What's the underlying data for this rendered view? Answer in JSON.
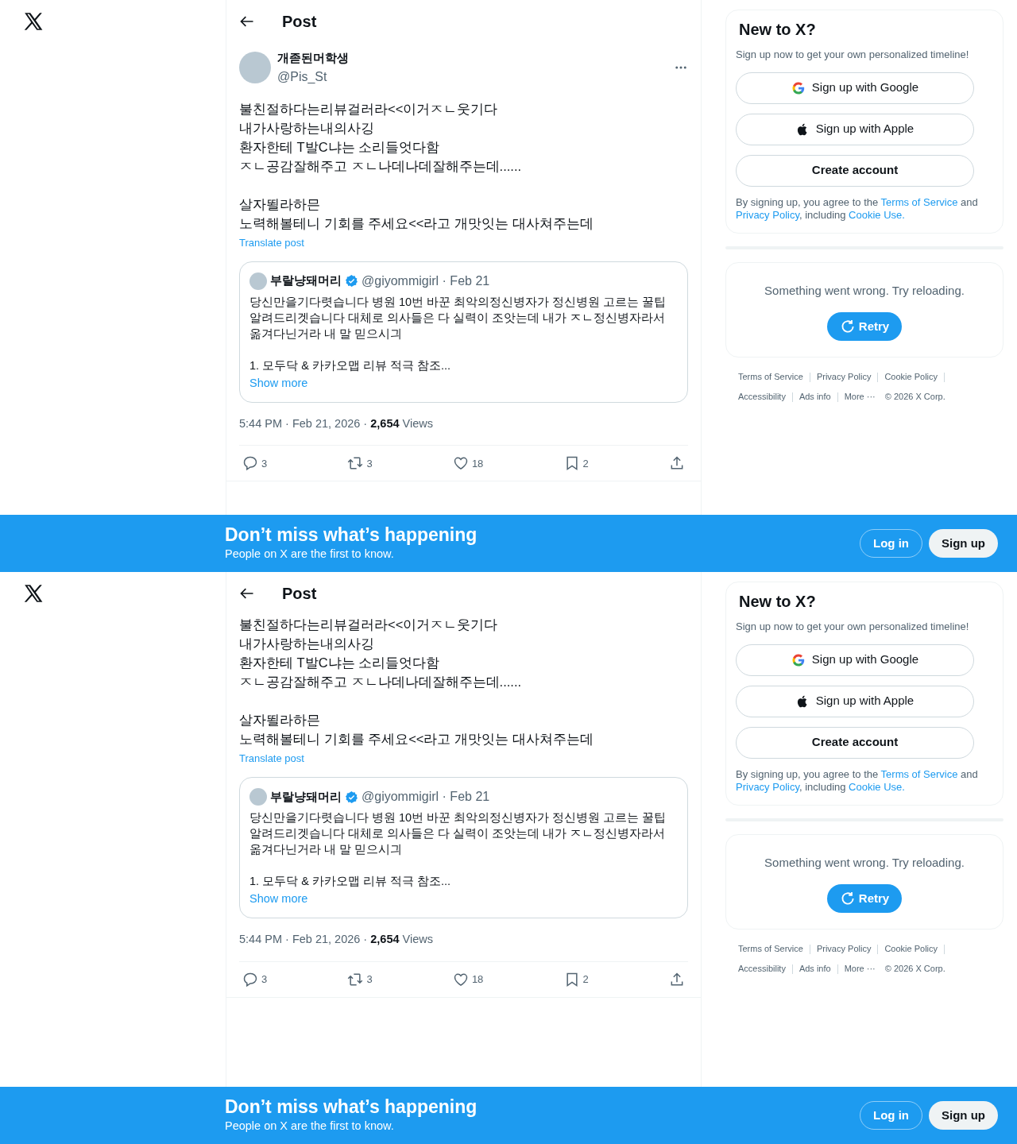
{
  "screens": [
    {
      "header": {
        "title": "Post"
      },
      "author": {
        "name": "개졷된머학생",
        "handle": "@Pis_St"
      },
      "body": [
        [
          "불친절하다는리뷰걸러라<<이거ㅈㄴ웃기다",
          "내가사랑하는내의사깅",
          "환자한테 T발C냐는 소리들엇다함",
          "ㅈㄴ공감잘해주고 ㅈㄴ나데나데잘해주는데......"
        ],
        [
          "살자뙬라하믄",
          "노력해볼테니 기회를 주세요<<라고 개맛잇는 대사쳐주는데"
        ]
      ],
      "translate": "Translate post",
      "quote": {
        "name": "부랄냥돼머리",
        "verified": true,
        "handle": "@giyommigirl · Feb 21",
        "text": [
          "당신만을기다렷습니다 병원 10번 바꾼 최악의정신병자가 정신병원 고르는 꿀팁 알려드리겟습니다 대체로 의사들은 다 실력이 조앗는데 내가 ㅈㄴ정신병자라서 옮겨다닌거라 내 말 믿으시긔",
          "1. 모두닥 & 카카오맵 리뷰 적극 참조..."
        ],
        "more": "Show more"
      },
      "meta": {
        "time": "5:44 PM · Feb 21, 2026 · ",
        "views": "2,654",
        "views_label": " Views"
      },
      "actions": [
        {
          "kind": "reply",
          "count": "3"
        },
        {
          "kind": "repost",
          "count": "3"
        },
        {
          "kind": "like",
          "count": "18"
        },
        {
          "kind": "bookmark",
          "count": "2"
        },
        {
          "kind": "share"
        }
      ],
      "signup": {
        "title": "New to X?",
        "subtitle": "Sign up now to get your own personalized timeline!",
        "buttons": [
          {
            "kind": "google",
            "label": "Sign up with Google"
          },
          {
            "kind": "apple",
            "label": "Sign up with Apple"
          },
          {
            "kind": "create",
            "label": "Create account"
          }
        ],
        "legal": [
          {
            "text": "By signing up, you agree to the ",
            "link": false
          },
          {
            "text": "Terms of Service",
            "link": true
          },
          {
            "text": " and ",
            "link": false
          },
          {
            "text": "Privacy Policy",
            "link": true
          },
          {
            "text": ", including ",
            "link": false
          },
          {
            "text": "Cookie Use.",
            "link": true
          }
        ]
      },
      "error": {
        "message": "Something went wrong. Try reloading.",
        "retry": "Retry"
      },
      "footer": [
        "Terms of Service",
        "Privacy Policy",
        "Cookie Policy",
        "Accessibility",
        "Ads info",
        "More ···",
        "© 2026 X Corp."
      ],
      "banner": {
        "title": "Don’t miss what’s happening",
        "subtitle": "People on X are the first to know.",
        "login": "Log in",
        "signup": "Sign up"
      }
    },
    {
      "header": {
        "title": "Post"
      },
      "body": [
        [
          "불친절하다는리뷰걸러라<<이거ㅈㄴ웃기다",
          "내가사랑하는내의사깅",
          "환자한테 T발C냐는 소리들엇다함",
          "ㅈㄴ공감잘해주고 ㅈㄴ나데나데잘해주는데......"
        ],
        [
          "살자뙬라하믄",
          "노력해볼테니 기회를 주세요<<라고 개맛잇는 대사쳐주는데"
        ]
      ],
      "translate": "Translate post",
      "quote": {
        "name": "부랄냥돼머리",
        "verified": true,
        "handle": "@giyommigirl · Feb 21",
        "text": [
          "당신만을기다렷습니다 병원 10번 바꾼 최악의정신병자가 정신병원 고르는 꿀팁 알려드리겟습니다 대체로 의사들은 다 실력이 조앗는데 내가 ㅈㄴ정신병자라서 옮겨다닌거라 내 말 믿으시긔",
          "1. 모두닥 & 카카오맵 리뷰 적극 참조..."
        ],
        "more": "Show more"
      },
      "meta": {
        "time": "5:44 PM · Feb 21, 2026 · ",
        "views": "2,654",
        "views_label": " Views"
      },
      "actions": [
        {
          "kind": "reply",
          "count": "3"
        },
        {
          "kind": "repost",
          "count": "3"
        },
        {
          "kind": "like",
          "count": "18"
        },
        {
          "kind": "bookmark",
          "count": "2"
        },
        {
          "kind": "share"
        }
      ],
      "signup": {
        "title": "New to X?",
        "subtitle": "Sign up now to get your own personalized timeline!",
        "buttons": [
          {
            "kind": "google",
            "label": "Sign up with Google"
          },
          {
            "kind": "apple",
            "label": "Sign up with Apple"
          },
          {
            "kind": "create",
            "label": "Create account"
          }
        ],
        "legal": [
          {
            "text": "By signing up, you agree to the ",
            "link": false
          },
          {
            "text": "Terms of Service",
            "link": true
          },
          {
            "text": " and ",
            "link": false
          },
          {
            "text": "Privacy Policy",
            "link": true
          },
          {
            "text": ", including ",
            "link": false
          },
          {
            "text": "Cookie Use.",
            "link": true
          }
        ]
      },
      "error": {
        "message": "Something went wrong. Try reloading.",
        "retry": "Retry"
      },
      "footer": [
        "Terms of Service",
        "Privacy Policy",
        "Cookie Policy",
        "Accessibility",
        "Ads info",
        "More ···",
        "© 2026 X Corp."
      ],
      "banner": {
        "title": "Don’t miss what’s happening",
        "subtitle": "People on X are the first to know.",
        "login": "Log in",
        "signup": "Sign up"
      }
    }
  ]
}
